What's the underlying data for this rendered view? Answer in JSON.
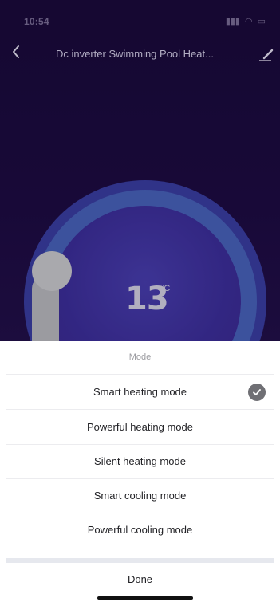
{
  "status_bar": {
    "time": "10:54",
    "icons": [
      "signal-icon",
      "wifi-icon",
      "battery-icon"
    ]
  },
  "nav": {
    "title": "Dc inverter Swimming Pool Heat...",
    "back_icon": "chevron-left-icon",
    "edit_icon": "edit-icon"
  },
  "dial": {
    "temperature": "13",
    "unit": "°C"
  },
  "mode_sheet": {
    "title": "Mode",
    "options": [
      {
        "label": "Smart heating mode",
        "selected": true
      },
      {
        "label": "Powerful heating mode",
        "selected": false
      },
      {
        "label": "Silent heating mode",
        "selected": false
      },
      {
        "label": "Smart cooling mode",
        "selected": false
      },
      {
        "label": "Powerful cooling mode",
        "selected": false
      }
    ],
    "done_label": "Done"
  },
  "colors": {
    "app_background": "#1e0c45",
    "dial_outer": "#3b3fa6",
    "dial_ring": "#4a64c0",
    "check": "#6f6f74"
  }
}
